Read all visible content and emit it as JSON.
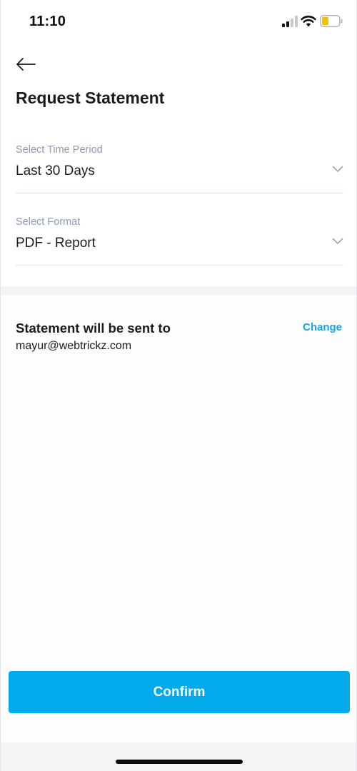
{
  "status_bar": {
    "time": "11:10",
    "icons": [
      "signal-icon",
      "wifi-icon",
      "battery-icon"
    ],
    "battery_color": "#f2c200"
  },
  "header": {
    "back_icon": "arrow-left-icon",
    "title": "Request Statement"
  },
  "form": {
    "time_period": {
      "label": "Select Time Period",
      "value": "Last 30 Days",
      "icon": "chevron-down-icon"
    },
    "format": {
      "label": "Select Format",
      "value": "PDF - Report",
      "icon": "chevron-down-icon"
    }
  },
  "recipient": {
    "heading": "Statement will be sent to",
    "change_label": "Change",
    "email": "mayur@webtrickz.com"
  },
  "actions": {
    "confirm_label": "Confirm"
  },
  "colors": {
    "accent": "#03aaeb",
    "link": "#1aa5e6",
    "label_gray": "#8d9bb1"
  }
}
